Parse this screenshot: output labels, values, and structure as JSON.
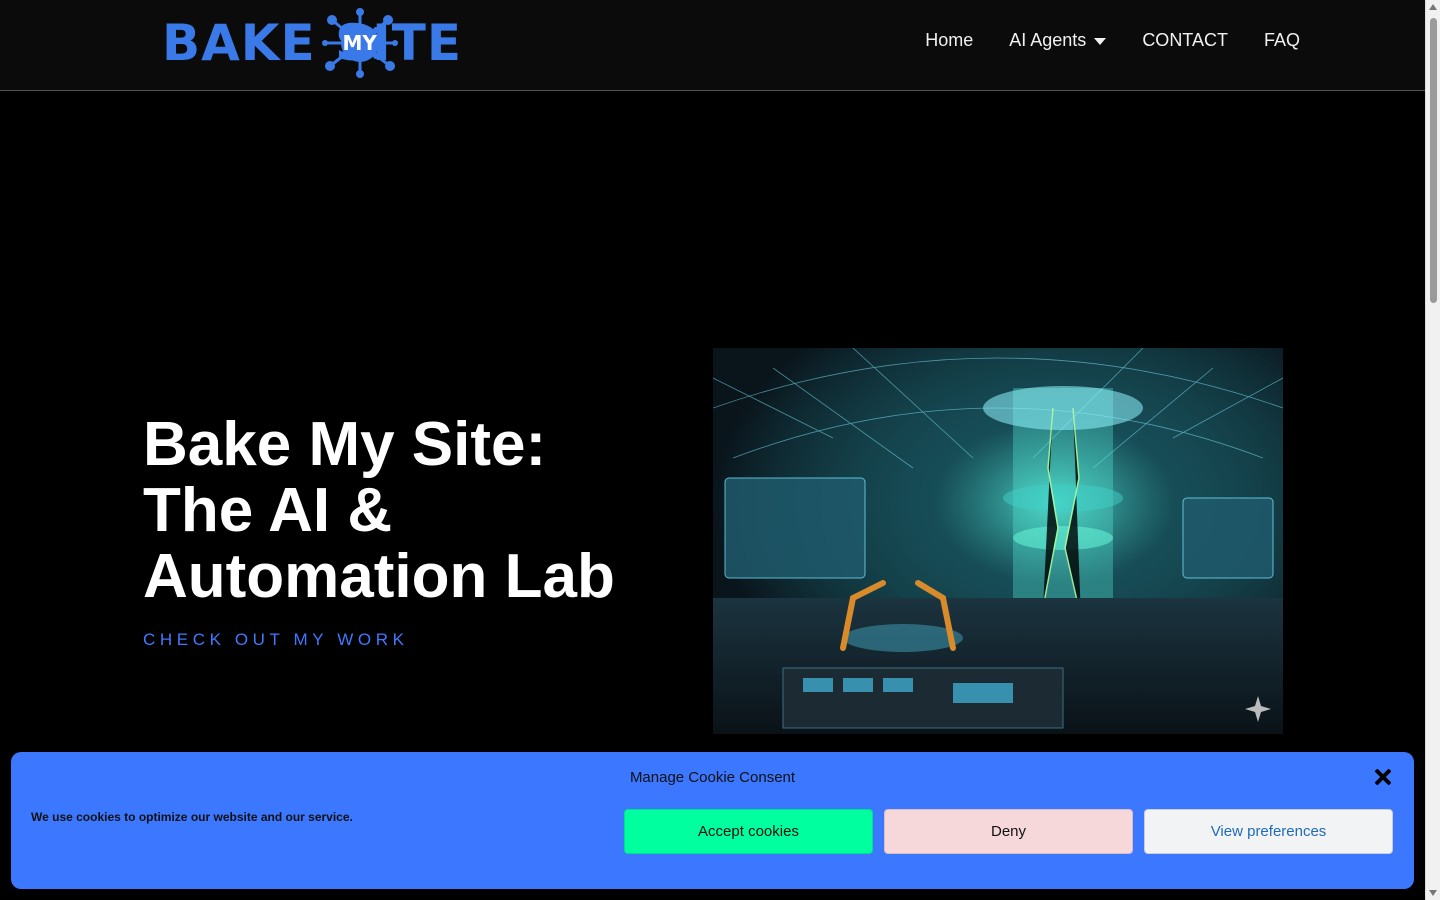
{
  "header": {
    "logo": {
      "word_left": "BAKE",
      "word_center": "MY",
      "word_right": "SITE",
      "color": "#3a7ae8"
    },
    "nav": [
      {
        "label": "Home"
      },
      {
        "label": "AI Agents",
        "has_dropdown": true
      },
      {
        "label": "CONTACT"
      },
      {
        "label": "FAQ"
      }
    ]
  },
  "hero": {
    "title_lines": [
      "Bake My Site:",
      "The AI &",
      "Automation Lab"
    ],
    "cta": "CHECK OUT MY WORK",
    "cta_color": "#3f78ff",
    "image_icon": "sparkle-icon"
  },
  "cookie_banner": {
    "title": "Manage Cookie Consent",
    "message": "We use cookies to optimize our website and our service.",
    "buttons": {
      "accept": "Accept cookies",
      "deny": "Deny",
      "preferences": "View preferences"
    },
    "close_icon": "close-icon",
    "background": "#3b77ff",
    "accept_color": "#00ff9f",
    "deny_color": "#f7d8da"
  }
}
